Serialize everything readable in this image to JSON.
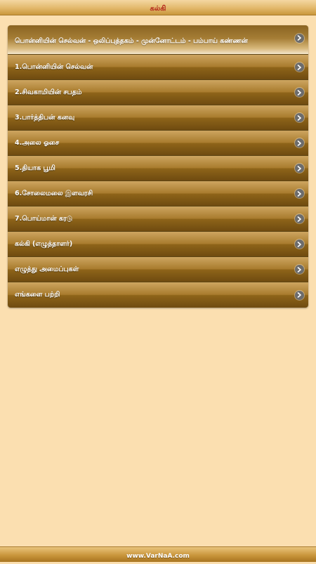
{
  "header": {
    "title": "கல்கி"
  },
  "menu": {
    "items": [
      {
        "label": "பொன்னியின் செல்வன் - ஒலிப்புத்தகம் - முன்னோட்டம் - பம்பாய் கண்ணன்"
      },
      {
        "label": "1.பொன்னியின் செல்வன்"
      },
      {
        "label": "2.சிவகாமியின் சபதம்"
      },
      {
        "label": "3.பார்த்திபன் கனவு"
      },
      {
        "label": "4.அலை ஓசை"
      },
      {
        "label": "5.தியாக பூமி"
      },
      {
        "label": "6.சோலைமலை இளவரசி"
      },
      {
        "label": "7.பொய்மான் கரடு"
      },
      {
        "label": "கல்கி (எழுத்தாளர்)"
      },
      {
        "label": "எழுத்து அமைப்புகள்"
      },
      {
        "label": "எங்களை பற்றி"
      }
    ],
    "chevron_icon": "chevron-right-icon"
  },
  "footer": {
    "site": "www.VarNaA.com"
  },
  "colors": {
    "background": "#fbdfb0",
    "title_red": "#b3251a",
    "item_gold": "#a97c2e",
    "chevron_gray": "#6c6c6c"
  }
}
